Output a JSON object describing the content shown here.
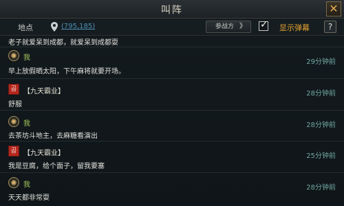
{
  "window": {
    "title": "叫阵"
  },
  "toolbar": {
    "location_label": "地点",
    "coords": "(795,185)",
    "camp_button": "参战方",
    "camp_chevron": "》",
    "danmu_checked": true,
    "danmu_label": "显示弹幕",
    "help_label": "?"
  },
  "messages": [
    {
      "text": "老子就爱呆到成都，就爱呆到成都耍"
    },
    {
      "avatar": "me",
      "name": "我",
      "time": "29分钟前",
      "text": "早上放假晒太阳，下午麻将就要开场。"
    },
    {
      "avatar": "red",
      "avatar_glyph": "곱",
      "guild": "【九天霸业】",
      "time": "28分钟前",
      "text": "舒服"
    },
    {
      "avatar": "me",
      "name": "我",
      "time": "28分钟前",
      "text": "去茶坊斗地主，去麻糖看演出"
    },
    {
      "avatar": "red",
      "avatar_glyph": "곱",
      "guild": "【九天霸业】",
      "time": "25分钟前",
      "text": "我是豆腐，给个面子，留我要塞"
    },
    {
      "avatar": "me",
      "name": "我",
      "time": "28分钟前",
      "text": "天天都非常耍"
    }
  ],
  "colors": {
    "accent_orange": "#e3a32f",
    "name_green": "#a3c65c",
    "time_teal": "#72a8a4",
    "coords_blue": "#4a8fb8"
  }
}
